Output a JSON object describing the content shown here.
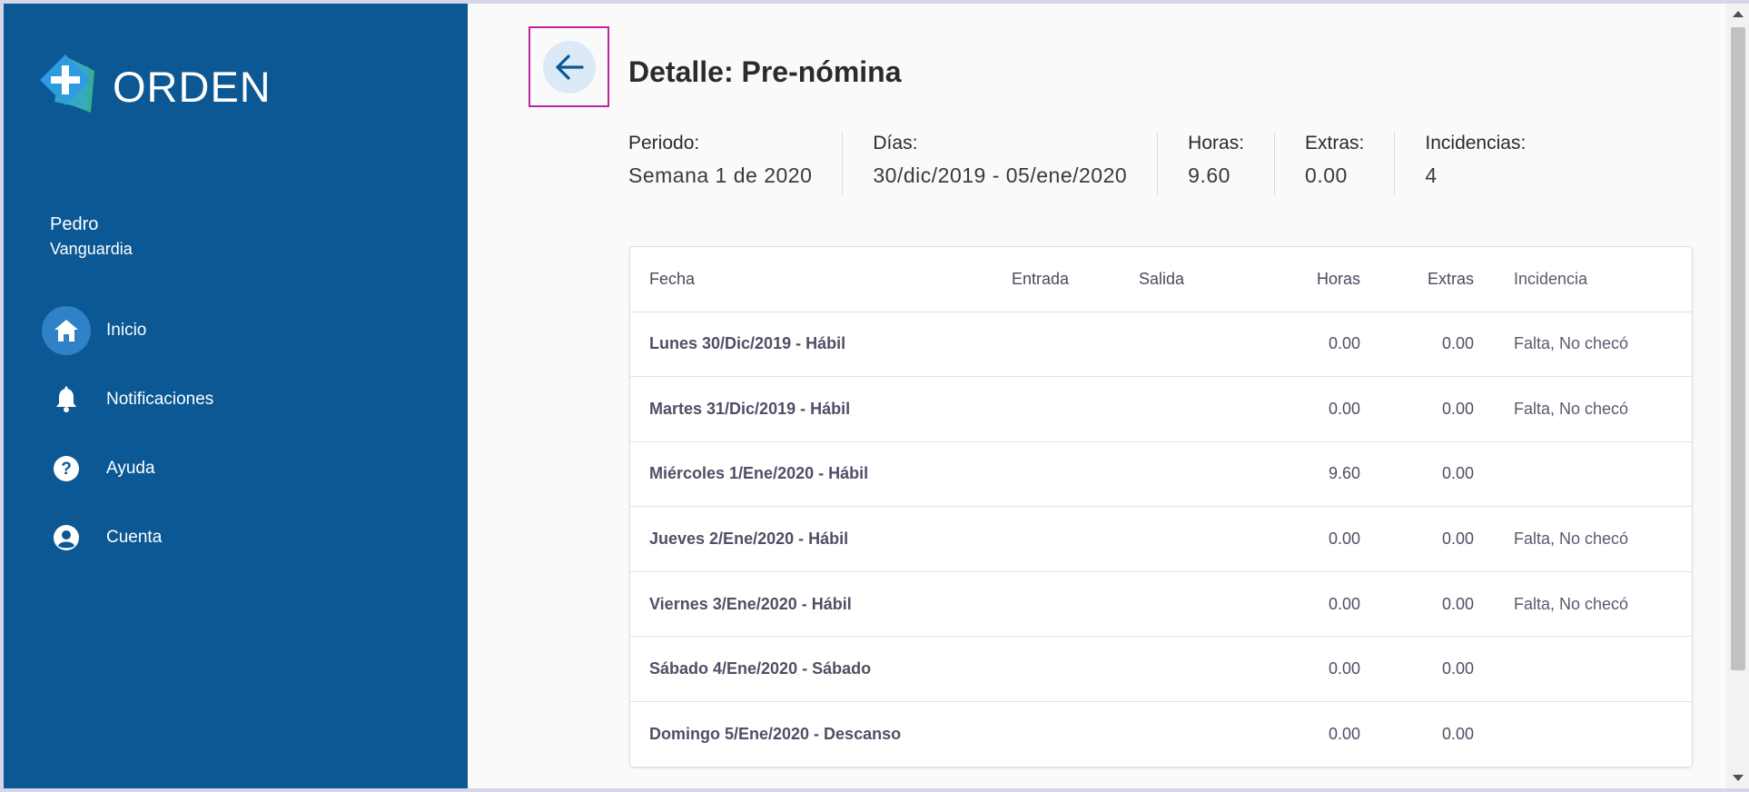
{
  "app": {
    "logo_text": "ORDEN"
  },
  "user": {
    "first_name": "Pedro",
    "last_name": "Vanguardia"
  },
  "nav": [
    {
      "label": "Inicio",
      "icon": "home-icon",
      "active": true
    },
    {
      "label": "Notificaciones",
      "icon": "bell-icon",
      "active": false
    },
    {
      "label": "Ayuda",
      "icon": "help-icon",
      "active": false
    },
    {
      "label": "Cuenta",
      "icon": "account-icon",
      "active": false
    }
  ],
  "page": {
    "title": "Detalle: Pre-nómina"
  },
  "summary": {
    "periodo_label": "Periodo:",
    "periodo_value": "Semana 1 de 2020",
    "dias_label": "Días:",
    "dias_value": "30/dic/2019 - 05/ene/2020",
    "horas_label": "Horas:",
    "horas_value": "9.60",
    "extras_label": "Extras:",
    "extras_value": "0.00",
    "incidencias_label": "Incidencias:",
    "incidencias_value": "4"
  },
  "table": {
    "headers": {
      "fecha": "Fecha",
      "entrada": "Entrada",
      "salida": "Salida",
      "horas": "Horas",
      "extras": "Extras",
      "incidencia": "Incidencia"
    },
    "rows": [
      {
        "fecha": "Lunes 30/Dic/2019 - Hábil",
        "entrada": "",
        "salida": "",
        "horas": "0.00",
        "extras": "0.00",
        "incidencia": "Falta, No checó"
      },
      {
        "fecha": "Martes 31/Dic/2019 - Hábil",
        "entrada": "",
        "salida": "",
        "horas": "0.00",
        "extras": "0.00",
        "incidencia": "Falta, No checó"
      },
      {
        "fecha": "Miércoles 1/Ene/2020 - Hábil",
        "entrada": "",
        "salida": "",
        "horas": "9.60",
        "extras": "0.00",
        "incidencia": ""
      },
      {
        "fecha": "Jueves 2/Ene/2020 - Hábil",
        "entrada": "",
        "salida": "",
        "horas": "0.00",
        "extras": "0.00",
        "incidencia": "Falta, No checó"
      },
      {
        "fecha": "Viernes 3/Ene/2020 - Hábil",
        "entrada": "",
        "salida": "",
        "horas": "0.00",
        "extras": "0.00",
        "incidencia": "Falta, No checó"
      },
      {
        "fecha": "Sábado 4/Ene/2020 - Sábado",
        "entrada": "",
        "salida": "",
        "horas": "0.00",
        "extras": "0.00",
        "incidencia": ""
      },
      {
        "fecha": "Domingo 5/Ene/2020 - Descanso",
        "entrada": "",
        "salida": "",
        "horas": "0.00",
        "extras": "0.00",
        "incidencia": ""
      }
    ]
  },
  "colors": {
    "sidebar": "#0b5895",
    "active_nav": "#2f82c7",
    "back_button_bg": "#dbeaf6",
    "highlight_box": "#c0249c"
  }
}
